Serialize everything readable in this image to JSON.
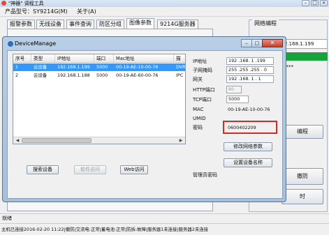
{
  "window": {
    "title": "\"神器\" 调程工具",
    "menu": [
      "产品型号：SY9214G(M)",
      "关于(A)"
    ]
  },
  "tabs": [
    "报警参数",
    "无线设备",
    "事件查询",
    "防区分组",
    "图像参数",
    "9214G服务器"
  ],
  "network": {
    "group_title": "网络编程",
    "ip_value": "2.168.1.199",
    "green_text": "器",
    "password_mask": "****",
    "program_button": "编程",
    "cancel_button": "撤防",
    "time_button": "时"
  },
  "dialog": {
    "title": "DeviceManage",
    "table": {
      "columns": [
        "序号",
        "类型",
        "IP地址",
        "端口",
        "Mac地址",
        "描"
      ],
      "rows": [
        [
          "1",
          "云设备",
          "192.168.1.199",
          "5000",
          "00-19-AE-10-00-76",
          "DVR"
        ],
        [
          "2",
          "云设备",
          "192.168.1.188",
          "5000",
          "00-19-AE-60-00-76",
          "IPC"
        ]
      ]
    },
    "buttons": {
      "search": "搜索设备",
      "soft_access": "软件访问",
      "web_access": "Web访问",
      "modify_network": "修改网络参数",
      "set_name": "设置设备名称"
    },
    "fields": {
      "ip_label": "IP地址",
      "ip_value": "192 .168. 1 .199",
      "mask_label": "子网掩码",
      "mask_value": "255 .255 .255 . 0",
      "gateway_label": "网关",
      "gateway_value": "192 .168. 1 . 1",
      "http_label": "HTTP端口",
      "http_value": "80",
      "tcp_label": "TCP端口",
      "tcp_value": "5000",
      "mac_label": "MAC",
      "mac_value": "00-19-AE-10-00-76",
      "umid_label": "UMID",
      "umid_value": "",
      "pwd_label": "密码",
      "pwd_value": "0600402209",
      "admin_pwd_label": "管理员密码"
    }
  },
  "status": {
    "line1": "就绪",
    "line2": "主机已连接2016-02-20 11:22|撤防|交流电:正常|蓄电池:正常|防拆:故障|服务器1未连接|服务器2未连接"
  },
  "colors": {
    "selection": "#3399ff",
    "highlight_border": "#e0251b",
    "green_status": "#17a23b"
  }
}
